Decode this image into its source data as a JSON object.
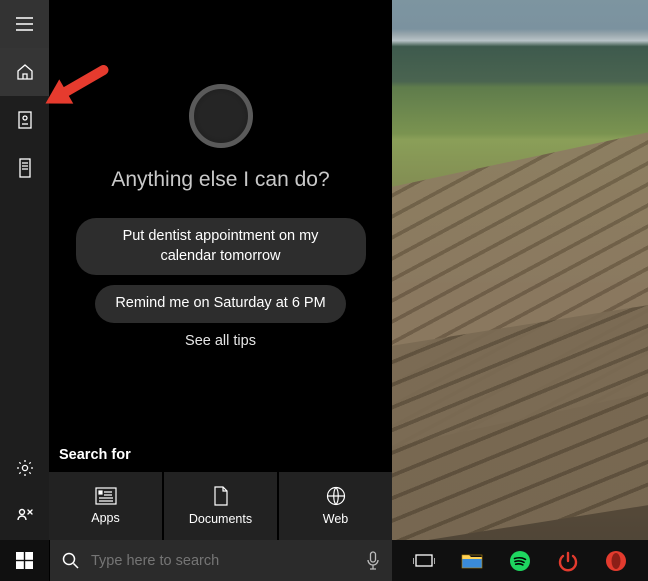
{
  "cortana": {
    "prompt": "Anything else I can do?",
    "suggestion1": "Put dentist appointment on my calendar tomorrow",
    "suggestion2": "Remind me on Saturday at 6 PM",
    "see_all": "See all tips",
    "search_for_label": "Search for",
    "categories": {
      "apps": "Apps",
      "documents": "Documents",
      "web": "Web"
    }
  },
  "searchbox": {
    "placeholder": "Type here to search"
  },
  "icons": {
    "hamburger": "menu-icon",
    "home": "home-icon",
    "notebook": "notebook-icon",
    "devices": "devices-icon",
    "settings": "gear-icon",
    "feedback": "feedback-icon"
  },
  "colors": {
    "spotify": "#1ed760",
    "opera_o": "#e33b2e",
    "power": "#e33b2e"
  }
}
